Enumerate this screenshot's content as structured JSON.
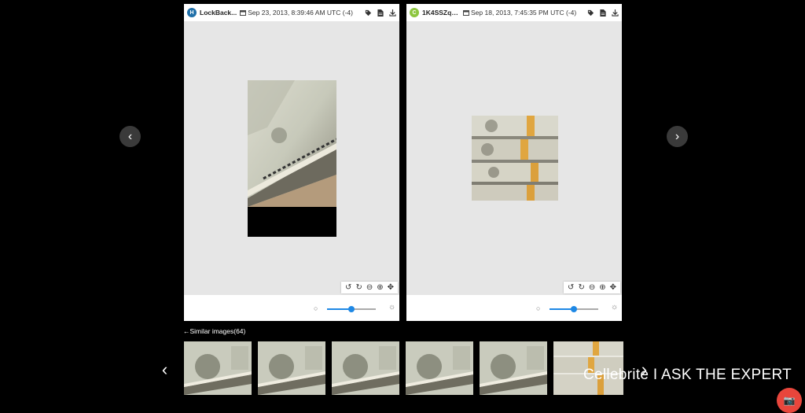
{
  "nav": {
    "prev_icon": "‹",
    "next_icon": "›"
  },
  "left_panel": {
    "badge": "H",
    "badge_color": "#1f6fa8",
    "filename": "LockBack...",
    "date": "Sep 23, 2013, 8:39:46 AM UTC (-4)"
  },
  "right_panel": {
    "badge": "C",
    "badge_color": "#8dc63f",
    "filename": "1K4SSZqo...",
    "date": "Sep 18, 2013, 7:45:35 PM UTC (-4)"
  },
  "icons": {
    "tag": "tag-icon",
    "doc": "document-icon",
    "download": "download-icon"
  },
  "toolbar_glyphs": {
    "rotate_left": "↺",
    "rotate_right": "↻",
    "zoom_out": "⊖",
    "zoom_in": "⊕",
    "fit": "✥"
  },
  "brightness": {
    "left_value": 0.5,
    "right_value": 0.5,
    "low_icon": "○",
    "high_icon": "☼"
  },
  "similar": {
    "title": "Similar images(64)",
    "back_icon": "←"
  },
  "thumbnails": [
    {
      "kind": "closeup"
    },
    {
      "kind": "closeup"
    },
    {
      "kind": "closeup"
    },
    {
      "kind": "closeup"
    },
    {
      "kind": "closeup"
    },
    {
      "kind": "stack"
    }
  ],
  "thumb_nav": {
    "prev_icon": "‹",
    "next_icon": "›"
  },
  "watermark": "Cellebrite  I  ASK THE EXPERT",
  "camera_icon": "📷",
  "colors": {
    "accent": "#1e88e5",
    "record": "#e8463c"
  }
}
